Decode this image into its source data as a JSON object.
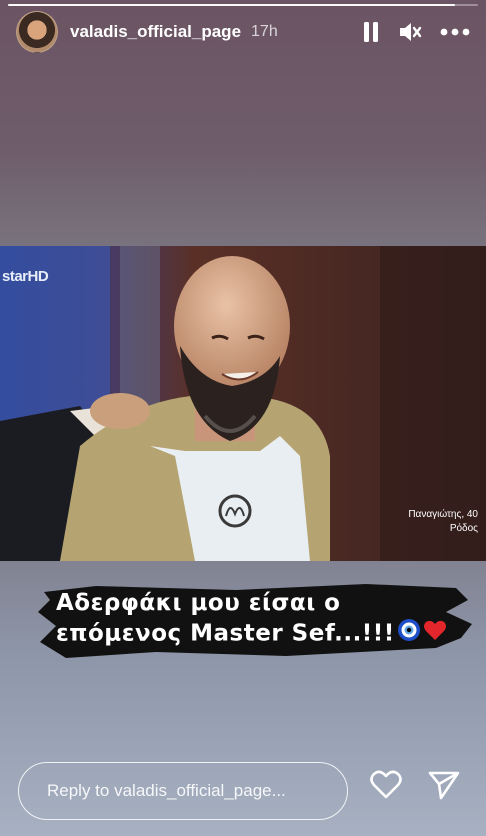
{
  "story": {
    "progress": 0.95
  },
  "header": {
    "username": "valadis_official_page",
    "time": "17h"
  },
  "photo": {
    "channel_logo": "starHD",
    "lower_third_name": "Παναγιώτης, 40",
    "lower_third_place": "Ρόδος"
  },
  "caption": {
    "line1": "Αδερφάκι μου είσαι ο",
    "line2": "επόμενος Master Sef...!!!"
  },
  "reply": {
    "placeholder": "Reply to valadis_official_page..."
  },
  "icons": {
    "pause": "pause-icon",
    "mute": "mute-icon",
    "more": "more-icon",
    "like": "heart-icon",
    "share": "send-icon",
    "evil_eye": "nazar-emoji",
    "heart_emoji": "red-heart-emoji"
  }
}
